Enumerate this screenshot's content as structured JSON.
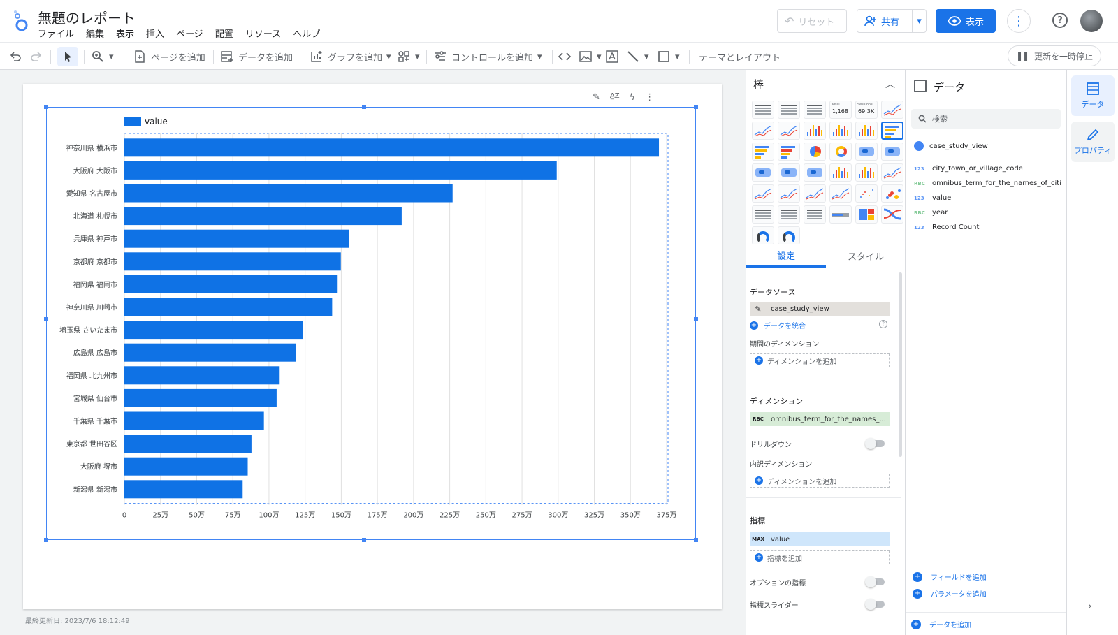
{
  "header": {
    "title": "無題のレポート",
    "menu": [
      "ファイル",
      "編集",
      "表示",
      "挿入",
      "ページ",
      "配置",
      "リソース",
      "ヘルプ"
    ],
    "reset_label": "リセット",
    "share_label": "共有",
    "view_label": "表示"
  },
  "toolbar": {
    "add_page": "ページを追加",
    "add_data": "データを追加",
    "add_chart": "グラフを追加",
    "add_control": "コントロールを追加",
    "theme_layout": "テーマとレイアウト",
    "pause_updates": "更新を一時停止"
  },
  "canvas": {
    "last_updated": "最終更新日: 2023/7/6 18:12:49"
  },
  "chart_data": {
    "type": "bar",
    "orientation": "horizontal",
    "categories": [
      "神奈川県 横浜市",
      "大阪府 大阪市",
      "愛知県 名古屋市",
      "北海道 札幌市",
      "兵庫県 神戸市",
      "京都府 京都市",
      "福岡県 福岡市",
      "神奈川県 川崎市",
      "埼玉県 さいたま市",
      "広島県 広島市",
      "福岡県 北九州市",
      "宮城県 仙台市",
      "千葉県 千葉市",
      "東京都 世田谷区",
      "大阪府 堺市",
      "新潟県 新潟市"
    ],
    "series": [
      {
        "name": "value",
        "values": [
          3697000,
          2990000,
          2270000,
          1918000,
          1555000,
          1497000,
          1475000,
          1437000,
          1234000,
          1186000,
          1074000,
          1053000,
          965000,
          879000,
          853000,
          818000
        ]
      }
    ],
    "xticks": [
      "0",
      "25万",
      "50万",
      "75万",
      "100万",
      "125万",
      "150万",
      "175万",
      "200万",
      "225万",
      "250万",
      "275万",
      "300万",
      "325万",
      "350万",
      "375万"
    ],
    "xlim": [
      0,
      3750000
    ],
    "grid": true,
    "legend": "top-left",
    "bar_color": "#0f72e5"
  },
  "chart_panel": {
    "title": "棒",
    "tab_setup": "設定",
    "tab_style": "スタイル",
    "thumb_total": "Total",
    "thumb_total_value": "1,168",
    "thumb_sessions": "Sessions",
    "thumb_sessions_value": "69.3K",
    "data_source_label": "データソース",
    "data_source": "case_study_view",
    "blend_data": "データを統合",
    "date_dim_label": "期間のディメンション",
    "add_dimension": "ディメンションを追加",
    "dimension_label": "ディメンション",
    "dimension_tag": "RBC",
    "dimension_value": "omnibus_term_for_the_names_...",
    "drilldown": "ドリルダウン",
    "breakdown_label": "内訳ディメンション",
    "metric_label": "指標",
    "metric_tag": "MAX",
    "metric_value": "value",
    "add_metric": "指標を追加",
    "optional_metrics": "オプションの指標",
    "metric_slider": "指標スライダー"
  },
  "data_panel": {
    "title": "データ",
    "search_placeholder": "検索",
    "source": "case_study_view",
    "fields": [
      {
        "type": "123",
        "name": "city_town_or_village_code"
      },
      {
        "type": "RBC",
        "name": "omnibus_term_for_the_names_of_citi..."
      },
      {
        "type": "123",
        "name": "value"
      },
      {
        "type": "RBC",
        "name": "year"
      },
      {
        "type": "123",
        "name": "Record Count"
      }
    ],
    "add_field": "フィールドを追加",
    "add_parameter": "パラメータを追加",
    "add_data": "データを追加"
  },
  "rail": {
    "data": "データ",
    "properties": "プロパティ"
  }
}
